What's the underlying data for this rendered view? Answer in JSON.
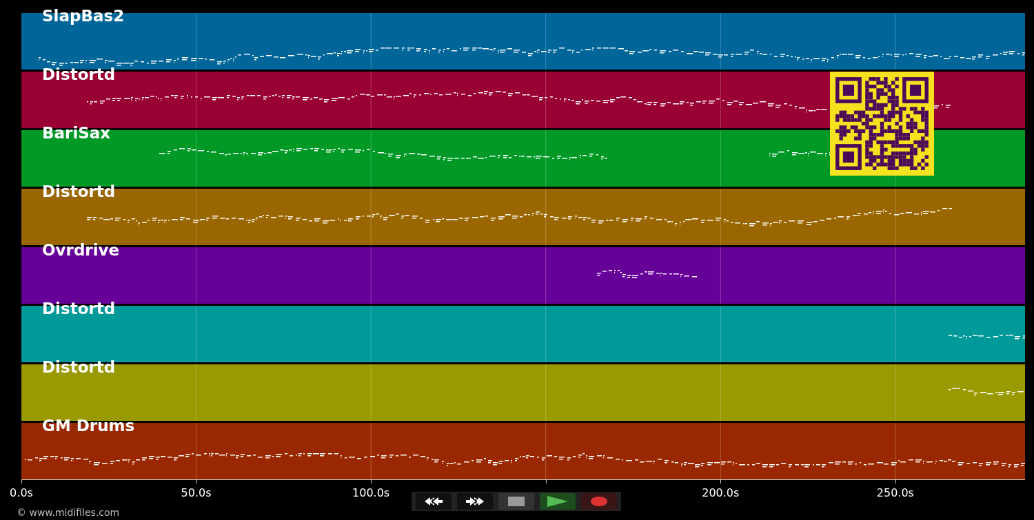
{
  "tracks": [
    {
      "name": "SlapBas2",
      "color": "#006699"
    },
    {
      "name": "Distortd",
      "color": "#990033"
    },
    {
      "name": "BariSax",
      "color": "#009926"
    },
    {
      "name": "Distortd",
      "color": "#996600"
    },
    {
      "name": "Ovrdrive",
      "color": "#660099"
    },
    {
      "name": "Distortd",
      "color": "#009999"
    },
    {
      "name": "Distortd",
      "color": "#999900"
    },
    {
      "name": "GM Drums",
      "color": "#992800"
    }
  ],
  "time_axis": {
    "ticks": [
      "0.0s",
      "50.0s",
      "100.0s",
      "200.0s",
      "250.0s"
    ]
  },
  "transport": {
    "buttons": [
      {
        "kind": "rewind"
      },
      {
        "kind": "forward"
      },
      {
        "kind": "stop"
      },
      {
        "kind": "play"
      },
      {
        "kind": "record"
      }
    ]
  },
  "footer": {
    "copyright": "© www.midifiles.com"
  }
}
